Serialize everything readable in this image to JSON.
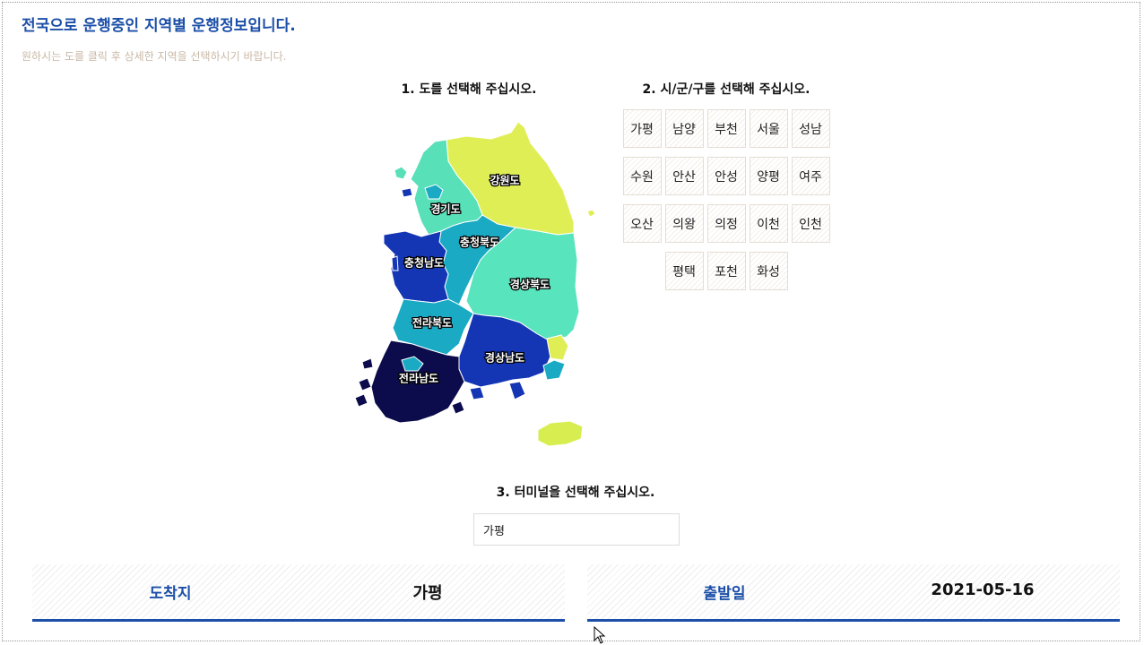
{
  "header": {
    "title": "전국으로 운행중인 지역별 운행정보입니다.",
    "subtitle": "원하시는 도를 클릭 후 상세한 지역을 선택하시기 바랍니다."
  },
  "steps": {
    "province": "1. 도를 선택해 주십시오.",
    "city": "2. 시/군/구를 선택해 주십시오.",
    "terminal": "3. 터미널을 선택해 주십시오."
  },
  "colors": {
    "accent": "#1c4fa8",
    "gangwon": "#e0ee56",
    "gyeonggi": "#58e0b8",
    "chungbuk": "#1aaac4",
    "chungnam": "#1436b4",
    "gyeongbuk": "#58e4bc",
    "jeonbuk": "#1aaac4",
    "gyeongnam": "#1436b4",
    "jeonnam": "#0c0c4c",
    "jeju": "#d8ee50"
  },
  "map": {
    "provinces": [
      {
        "id": "gangwon",
        "label": "강원도"
      },
      {
        "id": "gyeonggi",
        "label": "경기도"
      },
      {
        "id": "chungbuk",
        "label": "충청북도"
      },
      {
        "id": "chungnam",
        "label": "충청남도"
      },
      {
        "id": "gyeongbuk",
        "label": "경상북도"
      },
      {
        "id": "jeonbuk",
        "label": "전라북도"
      },
      {
        "id": "gyeongnam",
        "label": "경상남도"
      },
      {
        "id": "jeonnam",
        "label": "전라남도"
      }
    ]
  },
  "cities": {
    "rows": [
      [
        "가평",
        "남양",
        "부천",
        "서울",
        "성남"
      ],
      [
        "수원",
        "안산",
        "안성",
        "양평",
        "여주"
      ],
      [
        "오산",
        "의왕",
        "의정",
        "이천",
        "인천"
      ],
      [
        "평택",
        "포천",
        "화성"
      ]
    ]
  },
  "terminal": {
    "value": "가평"
  },
  "info": {
    "arrival_label": "도착지",
    "arrival_value": "가평",
    "departure_label": "출발일",
    "departure_value": "2021-05-16"
  }
}
